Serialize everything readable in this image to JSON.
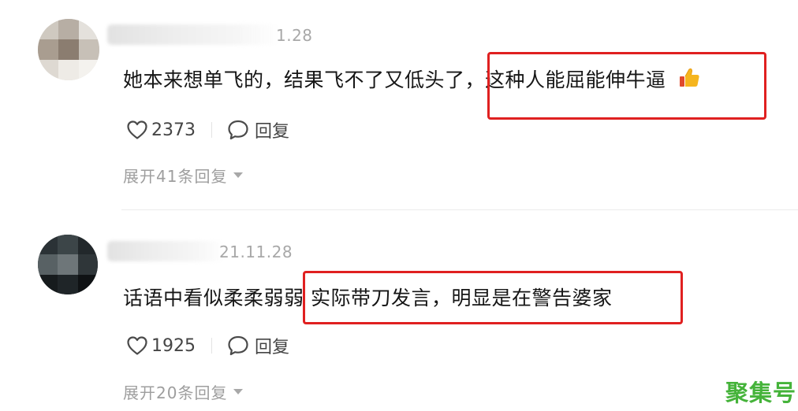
{
  "comments": [
    {
      "date": "1.28",
      "text_before": "她本来想单飞的，结果飞不了又低头了",
      "text_highlight": "，这种人能屈能伸牛逼",
      "emoji_icon": "thumbs-up-icon",
      "likes": "2373",
      "reply_label": "回复",
      "expand_label": "展开41条回复"
    },
    {
      "date": "21.11.28",
      "text_before": "话语中看似柔柔弱弱",
      "text_highlight": " 实际带刀发言，明显是在警告婆家",
      "likes": "1925",
      "reply_label": "回复",
      "expand_label": "展开20条回复"
    }
  ],
  "watermark": "聚集号",
  "colors": {
    "highlight_border": "#e02020",
    "watermark": "#45b33a",
    "muted_text": "#9e9e9e",
    "body_text": "#161616"
  }
}
